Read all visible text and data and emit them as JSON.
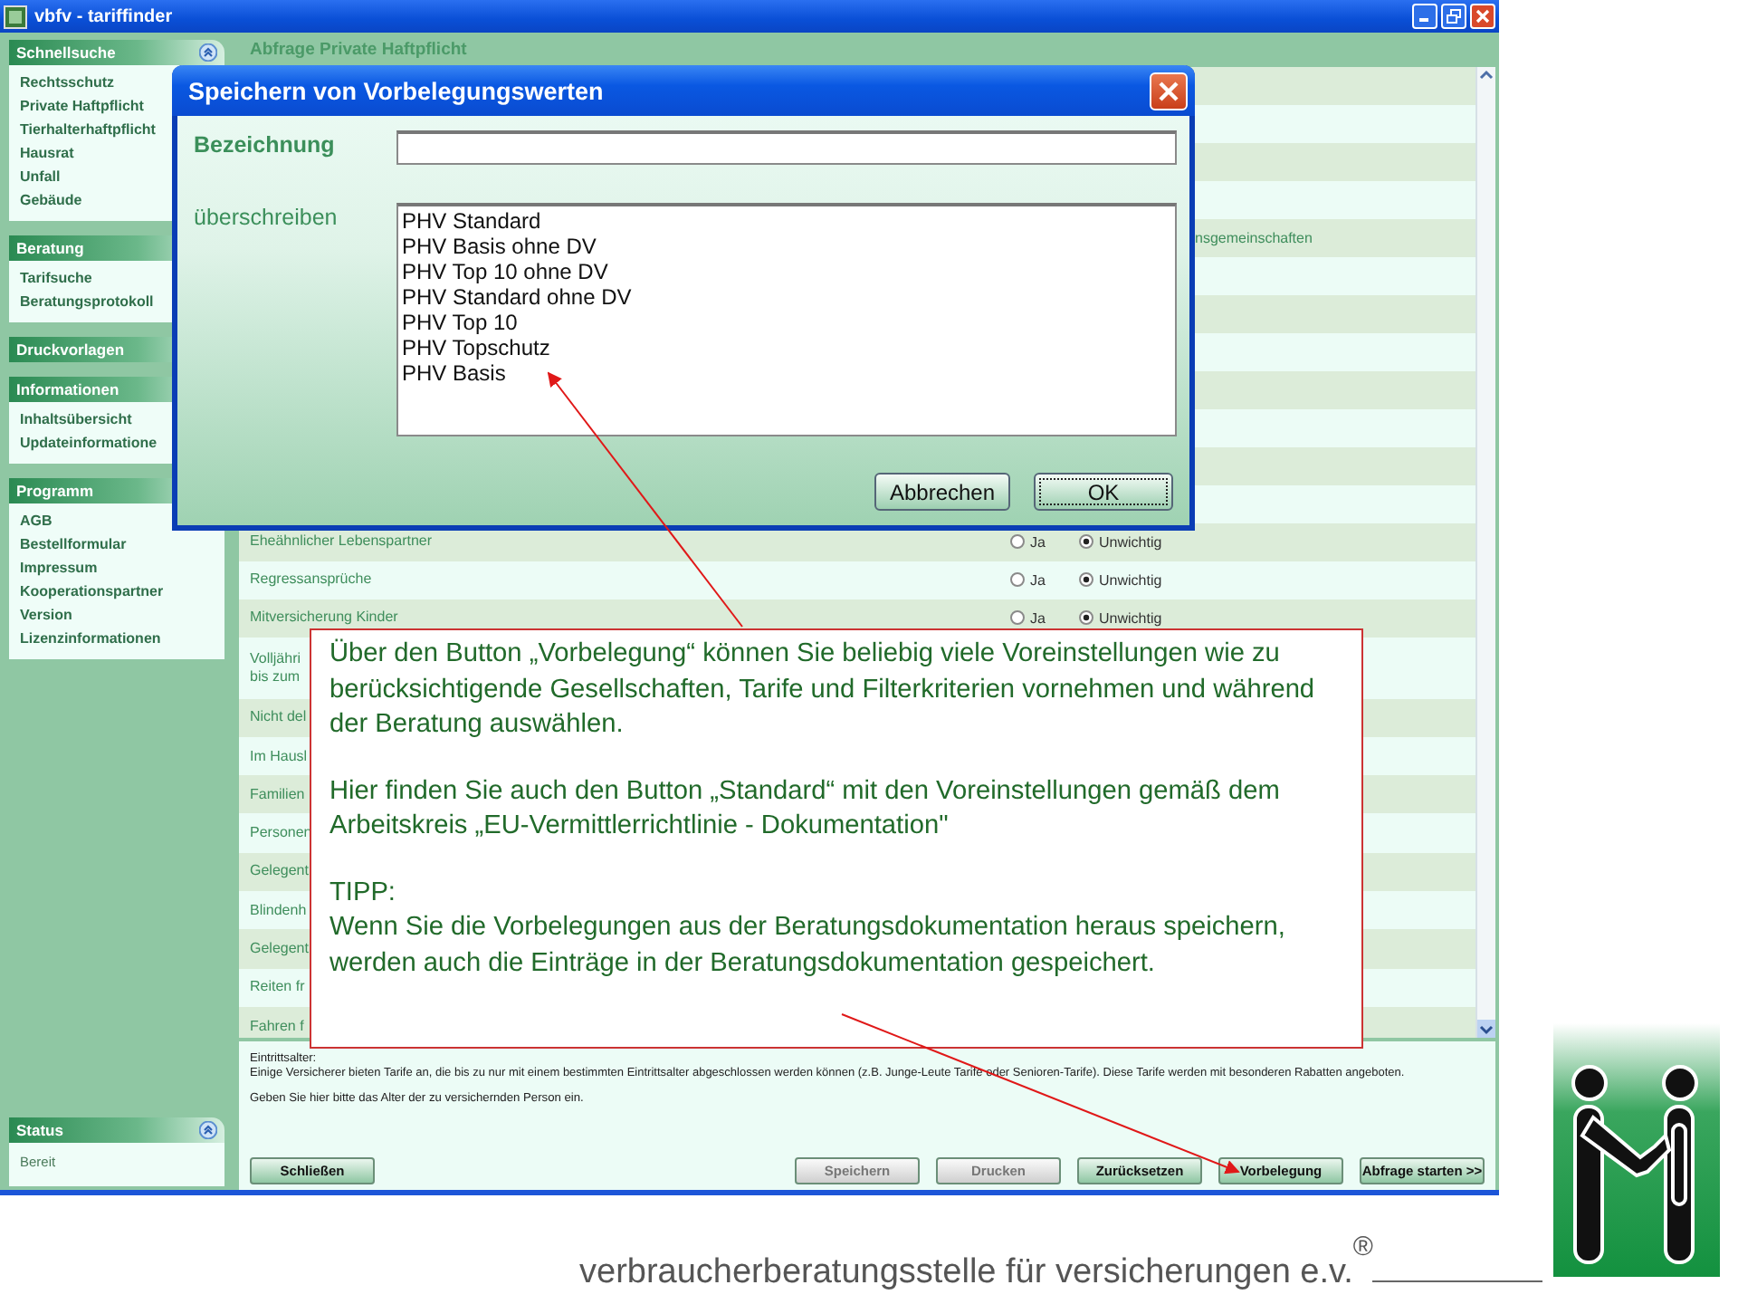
{
  "window": {
    "title": "vbfv - tariffinder"
  },
  "sidebar": {
    "sections": [
      {
        "title": "Schnellsuche",
        "collapsible": true,
        "items": [
          "Rechtsschutz",
          "Private Haftpflicht",
          "Tierhalterhaftpflicht",
          "Hausrat",
          "Unfall",
          "Gebäude"
        ]
      },
      {
        "title": "Beratung",
        "items": [
          "Tarifsuche",
          "Beratungsprotokoll"
        ]
      },
      {
        "title": "Druckvorlagen"
      },
      {
        "title": "Informationen",
        "items": [
          "Inhaltsübersicht",
          "Updateinformatione"
        ]
      },
      {
        "title": "Programm",
        "items": [
          "AGB",
          "Bestellformular",
          "Impressum",
          "Kooperationspartner",
          "Version",
          "Lizenzinformationen"
        ]
      }
    ],
    "status": {
      "title": "Status",
      "collapsible": true,
      "text": "Bereit"
    }
  },
  "main": {
    "title": "Abfrage Private Haftpflicht",
    "rows": [
      {
        "kind": "covered"
      },
      {
        "kind": "covered"
      },
      {
        "kind": "covered"
      },
      {
        "kind": "covered"
      },
      {
        "kind": "covered",
        "tail": "nsgemeinschaften"
      },
      {
        "kind": "covered"
      },
      {
        "kind": "covered"
      },
      {
        "kind": "covered"
      },
      {
        "kind": "covered"
      },
      {
        "kind": "covered"
      },
      {
        "kind": "covered"
      },
      {
        "kind": "covered"
      },
      {
        "kind": "option",
        "label": "Eheähnlicher Lebenspartner",
        "options": [
          {
            "label": "Ja",
            "selected": false
          },
          {
            "label": "Unwichtig",
            "selected": true
          }
        ]
      },
      {
        "kind": "option",
        "label": "Regressansprüche",
        "options": [
          {
            "label": "Ja",
            "selected": false
          },
          {
            "label": "Unwichtig",
            "selected": true
          }
        ]
      },
      {
        "kind": "option",
        "label": "Mitversicherung Kinder",
        "options": [
          {
            "label": "Ja",
            "selected": false
          },
          {
            "label": "Unwichtig",
            "selected": true
          }
        ]
      },
      {
        "kind": "double",
        "label": "Volljähri",
        "label_2": "bis zum"
      },
      {
        "kind": "text",
        "label": "Nicht del"
      },
      {
        "kind": "text",
        "label": "Im Hausl"
      },
      {
        "kind": "text",
        "label": "Familien"
      },
      {
        "kind": "text",
        "label": "Personen"
      },
      {
        "kind": "text",
        "label": "Gelegent"
      },
      {
        "kind": "text",
        "label": "Blindenh"
      },
      {
        "kind": "text",
        "label": "Gelegent"
      },
      {
        "kind": "text",
        "label": "Reiten fr"
      },
      {
        "kind": "text",
        "label": "Fahren f"
      }
    ]
  },
  "info": {
    "heading": "Eintrittsalter:",
    "text": "Einige Versicherer bieten Tarife an, die bis zu nur mit einem bestimmten Eintrittsalter abgeschlossen werden können (z.B. Junge-Leute Tarife oder Senioren-Tarife). Diese Tarife werden mit besonderen Rabatten angeboten.",
    "hint": "Geben Sie hier bitte das Alter der zu versichernden Person ein."
  },
  "close_button": {
    "label": "Schließen"
  },
  "buttons": [
    {
      "label": "Speichern",
      "disabled": true
    },
    {
      "label": "Drucken",
      "disabled": true
    },
    {
      "label": "Zurücksetzen",
      "disabled": false
    },
    {
      "label": "Vorbelegung",
      "disabled": false
    },
    {
      "label": "Abfrage starten  >>",
      "disabled": false
    }
  ],
  "dialog": {
    "title": "Speichern von Vorbelegungswerten",
    "name_label": "Bezeichnung",
    "overwrite_label": "überschreiben",
    "presets": [
      {
        "label": "PHV Standard",
        "selected": false
      },
      {
        "label": "PHV Basis ohne DV",
        "selected": false
      },
      {
        "label": "PHV Top 10 ohne DV",
        "selected": false
      },
      {
        "label": "PHV Standard ohne DV",
        "selected": false
      },
      {
        "label": "PHV Top 10",
        "selected": false
      },
      {
        "label": "PHV Topschutz",
        "selected": false
      },
      {
        "label": "PHV Basis",
        "selected": false
      }
    ],
    "buttons": [
      {
        "label": "Abbrechen",
        "focused": false
      },
      {
        "label": "OK",
        "focused": true
      }
    ]
  },
  "callout": {
    "paragraphs": [
      "Über den Button „Vorbelegung“ können Sie beliebig viele Voreinstellungen wie zu berücksichtigende Gesellschaften, Tarife und Filterkriterien vornehmen und während der Beratung auswählen.",
      "Hier finden Sie auch den Button „Standard“ mit den Voreinstellungen gemäß dem Arbeitskreis „EU-Vermittlerrichtlinie - Dokumentation\""
    ],
    "tip": {
      "heading": "TIPP:",
      "text": "Wenn Sie die Vorbelegungen aus der Beratungsdokumentation heraus speichern, werden auch die Einträge in der Beratungsdokumentation gespeichert."
    }
  },
  "footer": {
    "tagline": "verbraucherberatungsstelle für versicherungen e.v.",
    "mark": "®"
  }
}
